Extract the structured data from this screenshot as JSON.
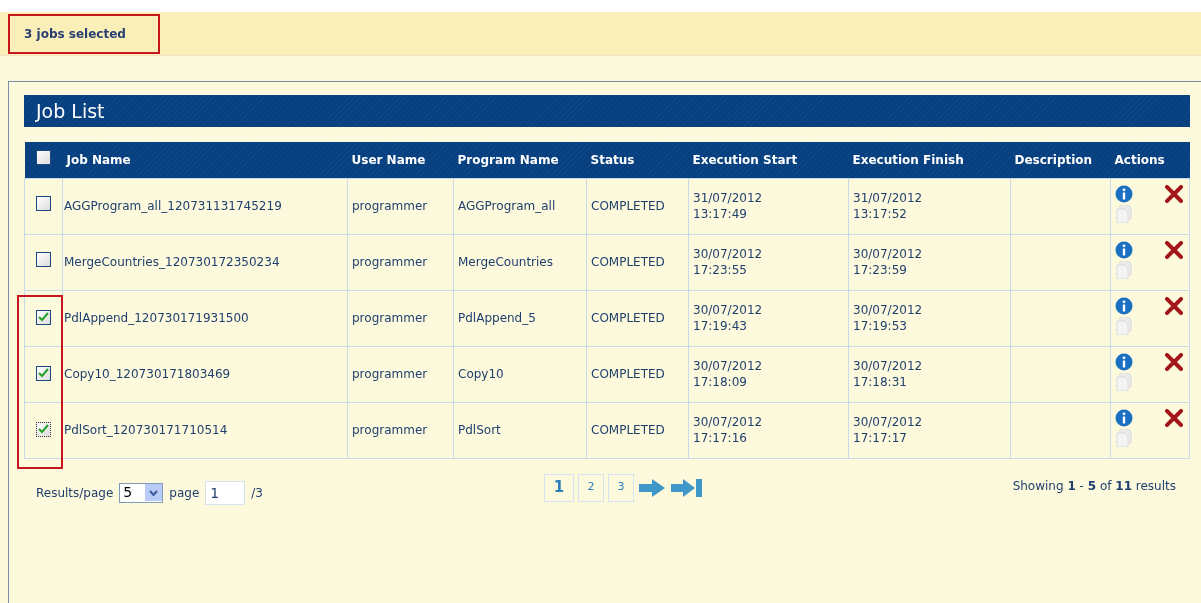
{
  "selection_status": "3 jobs selected",
  "panel_title": "Job List",
  "table": {
    "select_all": {
      "checked": false
    },
    "columns": [
      "Job Name",
      "User Name",
      "Program Name",
      "Status",
      "Execution Start",
      "Execution Finish",
      "Description",
      "Actions"
    ],
    "rows": [
      {
        "checked": false,
        "focused": false,
        "job_name": "AGGProgram_all_120731131745219",
        "user_name": "programmer",
        "program_name": "AGGProgram_all",
        "status": "COMPLETED",
        "start_date": "31/07/2012",
        "start_time": "13:17:49",
        "finish_date": "31/07/2012",
        "finish_time": "13:17:52"
      },
      {
        "checked": false,
        "focused": false,
        "job_name": "MergeCountries_120730172350234",
        "user_name": "programmer",
        "program_name": "MergeCountries",
        "status": "COMPLETED",
        "start_date": "30/07/2012",
        "start_time": "17:23:55",
        "finish_date": "30/07/2012",
        "finish_time": "17:23:59"
      },
      {
        "checked": true,
        "focused": false,
        "job_name": "PdlAppend_120730171931500",
        "user_name": "programmer",
        "program_name": "PdlAppend_5",
        "status": "COMPLETED",
        "start_date": "30/07/2012",
        "start_time": "17:19:43",
        "finish_date": "30/07/2012",
        "finish_time": "17:19:53"
      },
      {
        "checked": true,
        "focused": false,
        "job_name": "Copy10_120730171803469",
        "user_name": "programmer",
        "program_name": "Copy10",
        "status": "COMPLETED",
        "start_date": "30/07/2012",
        "start_time": "17:18:09",
        "finish_date": "30/07/2012",
        "finish_time": "17:18:31"
      },
      {
        "checked": true,
        "focused": true,
        "job_name": "PdlSort_120730171710514",
        "user_name": "programmer",
        "program_name": "PdlSort",
        "status": "COMPLETED",
        "start_date": "30/07/2012",
        "start_time": "17:17:16",
        "finish_date": "30/07/2012",
        "finish_time": "17:17:17"
      }
    ]
  },
  "pagination": {
    "results_label": "Results/page",
    "per_page": "5",
    "page_label": "page",
    "page_value": "1",
    "page_total": "/3",
    "pages": [
      {
        "label": "1",
        "selected": true
      },
      {
        "label": "2",
        "selected": false
      },
      {
        "label": "3",
        "selected": false
      }
    ],
    "summary": "Showing **1** - **5** of **11** results"
  }
}
